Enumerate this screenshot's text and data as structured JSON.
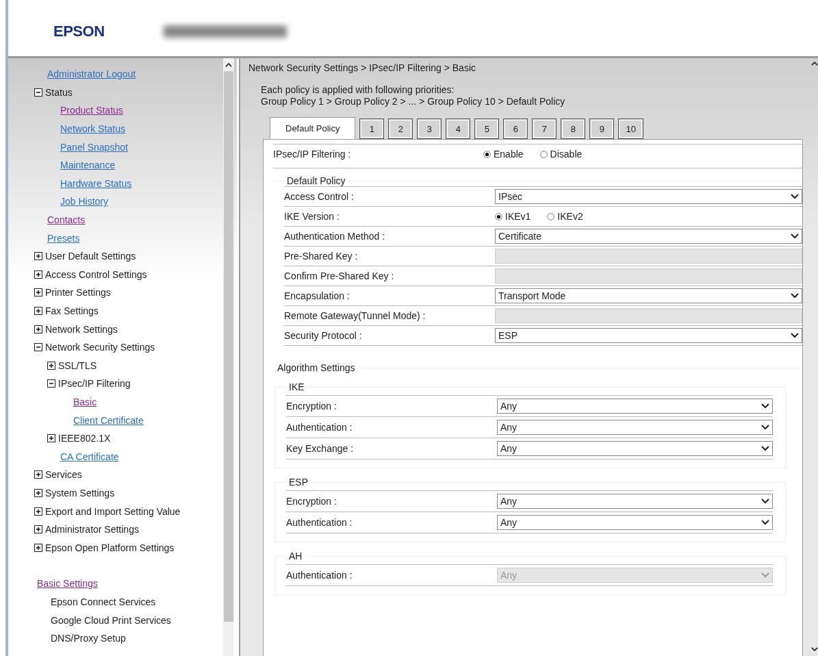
{
  "header": {
    "logo": "EPSON"
  },
  "sidebar": {
    "items": [
      {
        "kind": "link",
        "label": "Administrator Logout",
        "visited": false
      },
      {
        "kind": "group",
        "label": "Status",
        "expanded": true,
        "children": [
          {
            "kind": "link",
            "label": "Product Status",
            "visited": true
          },
          {
            "kind": "link",
            "label": "Network Status",
            "visited": false
          },
          {
            "kind": "link",
            "label": "Panel Snapshot",
            "visited": false
          },
          {
            "kind": "link",
            "label": "Maintenance",
            "visited": false
          },
          {
            "kind": "link",
            "label": "Hardware Status",
            "visited": false
          },
          {
            "kind": "link",
            "label": "Job History",
            "visited": false
          }
        ]
      },
      {
        "kind": "link",
        "label": "Contacts",
        "visited": true
      },
      {
        "kind": "link",
        "label": "Presets",
        "visited": false
      },
      {
        "kind": "group",
        "label": "User Default Settings",
        "expanded": false
      },
      {
        "kind": "group",
        "label": "Access Control Settings",
        "expanded": false
      },
      {
        "kind": "group",
        "label": "Printer Settings",
        "expanded": false
      },
      {
        "kind": "group",
        "label": "Fax Settings",
        "expanded": false
      },
      {
        "kind": "group",
        "label": "Network Settings",
        "expanded": false
      },
      {
        "kind": "group",
        "label": "Network Security Settings",
        "expanded": true,
        "children": [
          {
            "kind": "group",
            "label": "SSL/TLS",
            "expanded": false
          },
          {
            "kind": "group",
            "label": "IPsec/IP Filtering",
            "expanded": true,
            "children": [
              {
                "kind": "link",
                "label": "Basic",
                "visited": true
              },
              {
                "kind": "link",
                "label": "Client Certificate",
                "visited": false
              }
            ]
          },
          {
            "kind": "group",
            "label": "IEEE802.1X",
            "expanded": false
          },
          {
            "kind": "link",
            "label": "CA Certificate",
            "visited": false
          }
        ]
      },
      {
        "kind": "group",
        "label": "Services",
        "expanded": false
      },
      {
        "kind": "group",
        "label": "System Settings",
        "expanded": false
      },
      {
        "kind": "group",
        "label": "Export and Import Setting Value",
        "expanded": false
      },
      {
        "kind": "group",
        "label": "Administrator Settings",
        "expanded": false
      },
      {
        "kind": "group",
        "label": "Epson Open Platform Settings",
        "expanded": false
      }
    ],
    "basic_settings": {
      "label": "Basic Settings",
      "visited": true
    },
    "basic_items": [
      "Epson Connect Services",
      "Google Cloud Print Services",
      "DNS/Proxy Setup"
    ]
  },
  "breadcrumb": "Network Security Settings > IPsec/IP Filtering > Basic",
  "intro": [
    "Each policy is applied with following priorities:",
    "Group Policy 1 > Group Policy 2 > ... > Group Policy 10 > Default Policy"
  ],
  "tabs": [
    {
      "label": "Default Policy",
      "selected": true
    },
    {
      "label": "1",
      "selected": false
    },
    {
      "label": "2",
      "selected": false
    },
    {
      "label": "3",
      "selected": false
    },
    {
      "label": "4",
      "selected": false
    },
    {
      "label": "5",
      "selected": false
    },
    {
      "label": "6",
      "selected": false
    },
    {
      "label": "7",
      "selected": false
    },
    {
      "label": "8",
      "selected": false
    },
    {
      "label": "9",
      "selected": false
    },
    {
      "label": "10",
      "selected": false
    }
  ],
  "filtering": {
    "kind": "radio",
    "label": "IPsec/IP Filtering :",
    "options": [
      {
        "label": "Enable",
        "selected": true
      },
      {
        "label": "Disable",
        "selected": false
      }
    ]
  },
  "default_policy": {
    "legend": "Default Policy",
    "fields": [
      {
        "kind": "select",
        "label": "Access Control :",
        "value": "IPsec",
        "disabled": false
      },
      {
        "kind": "radio",
        "label": "IKE Version :",
        "options": [
          {
            "label": "IKEv1",
            "selected": true
          },
          {
            "label": "IKEv2",
            "selected": false
          }
        ]
      },
      {
        "kind": "select",
        "label": "Authentication Method :",
        "value": "Certificate",
        "disabled": false
      },
      {
        "kind": "input",
        "label": "Pre-Shared Key :",
        "disabled": true
      },
      {
        "kind": "input",
        "label": "Confirm Pre-Shared Key :",
        "disabled": true
      },
      {
        "kind": "select",
        "label": "Encapsulation :",
        "value": "Transport Mode",
        "disabled": false
      },
      {
        "kind": "input",
        "label": "Remote Gateway(Tunnel Mode) :",
        "disabled": true
      },
      {
        "kind": "select",
        "label": "Security Protocol :",
        "value": "ESP",
        "disabled": false
      }
    ]
  },
  "algorithm_settings": {
    "legend": "Algorithm Settings",
    "groups": [
      {
        "legend": "IKE",
        "fields": [
          {
            "kind": "select",
            "label": "Encryption :",
            "value": "Any",
            "disabled": false
          },
          {
            "kind": "select",
            "label": "Authentication :",
            "value": "Any",
            "disabled": false
          },
          {
            "kind": "select",
            "label": "Key Exchange :",
            "value": "Any",
            "disabled": false
          }
        ]
      },
      {
        "legend": "ESP",
        "fields": [
          {
            "kind": "select",
            "label": "Encryption :",
            "value": "Any",
            "disabled": false
          },
          {
            "kind": "select",
            "label": "Authentication :",
            "value": "Any",
            "disabled": false
          }
        ]
      },
      {
        "legend": "AH",
        "fields": [
          {
            "kind": "select",
            "label": "Authentication :",
            "value": "Any",
            "disabled": true
          }
        ]
      }
    ]
  }
}
